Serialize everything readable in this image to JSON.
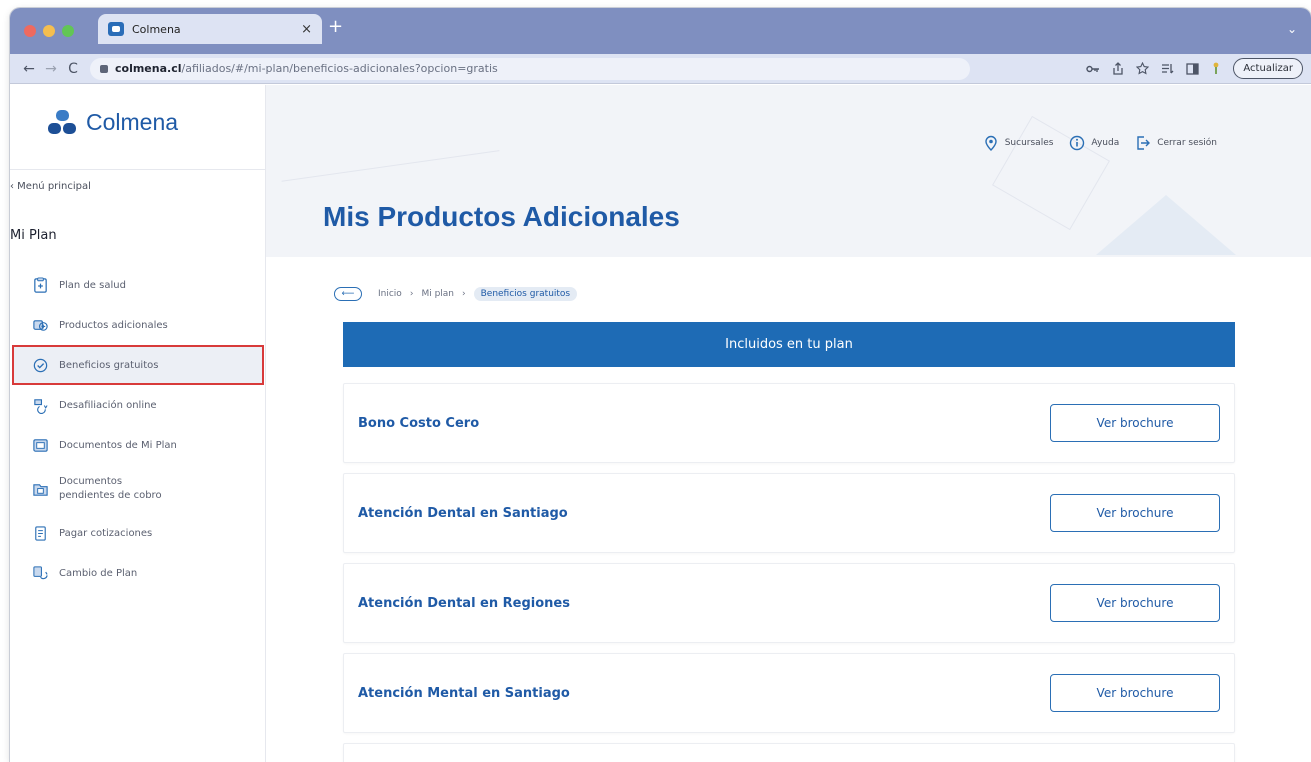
{
  "browser": {
    "tab_title": "Colmena",
    "tab_close": "×",
    "new_tab": "+",
    "tabstrip_chevron": "⌄",
    "url_host": "colmena.cl",
    "url_path": "/afiliados/#/mi-plan/beneficios-adicionales?opcion=gratis",
    "update_label": "Actualizar",
    "back_icon": "←",
    "forward_icon": "→",
    "reload_icon": "C"
  },
  "sidebar": {
    "logo_text": "Colmena",
    "back_link": "‹ Menú principal",
    "section_title": "Mi Plan",
    "items": [
      {
        "label": "Plan de salud"
      },
      {
        "label": "Productos adicionales"
      },
      {
        "label": "Beneficios gratuitos"
      },
      {
        "label": "Desafiliación online"
      },
      {
        "label": "Documentos de Mi Plan"
      },
      {
        "label": "Documentos pendientes de cobro"
      },
      {
        "label": "Pagar cotizaciones"
      },
      {
        "label": "Cambio de Plan"
      }
    ]
  },
  "header": {
    "links": [
      {
        "label": "Sucursales"
      },
      {
        "label": "Ayuda"
      },
      {
        "label": "Cerrar sesión"
      }
    ],
    "page_title": "Mis Productos Adicionales"
  },
  "breadcrumb": {
    "back_icon": "⟵",
    "items": [
      "Inicio",
      "Mi plan",
      "Beneficios gratuitos"
    ],
    "separator": "›"
  },
  "main": {
    "banner": "Incluidos en tu plan",
    "benefits": [
      {
        "name": "Bono Costo Cero",
        "button": "Ver brochure"
      },
      {
        "name": "Atención Dental en Santiago",
        "button": "Ver brochure"
      },
      {
        "name": "Atención Dental en Regiones",
        "button": "Ver brochure"
      },
      {
        "name": "Atención Mental en Santiago",
        "button": "Ver brochure"
      }
    ]
  },
  "colors": {
    "brand_blue": "#1f5aa6",
    "banner_blue": "#1e6bb5",
    "highlight_red": "#d83a3a"
  }
}
